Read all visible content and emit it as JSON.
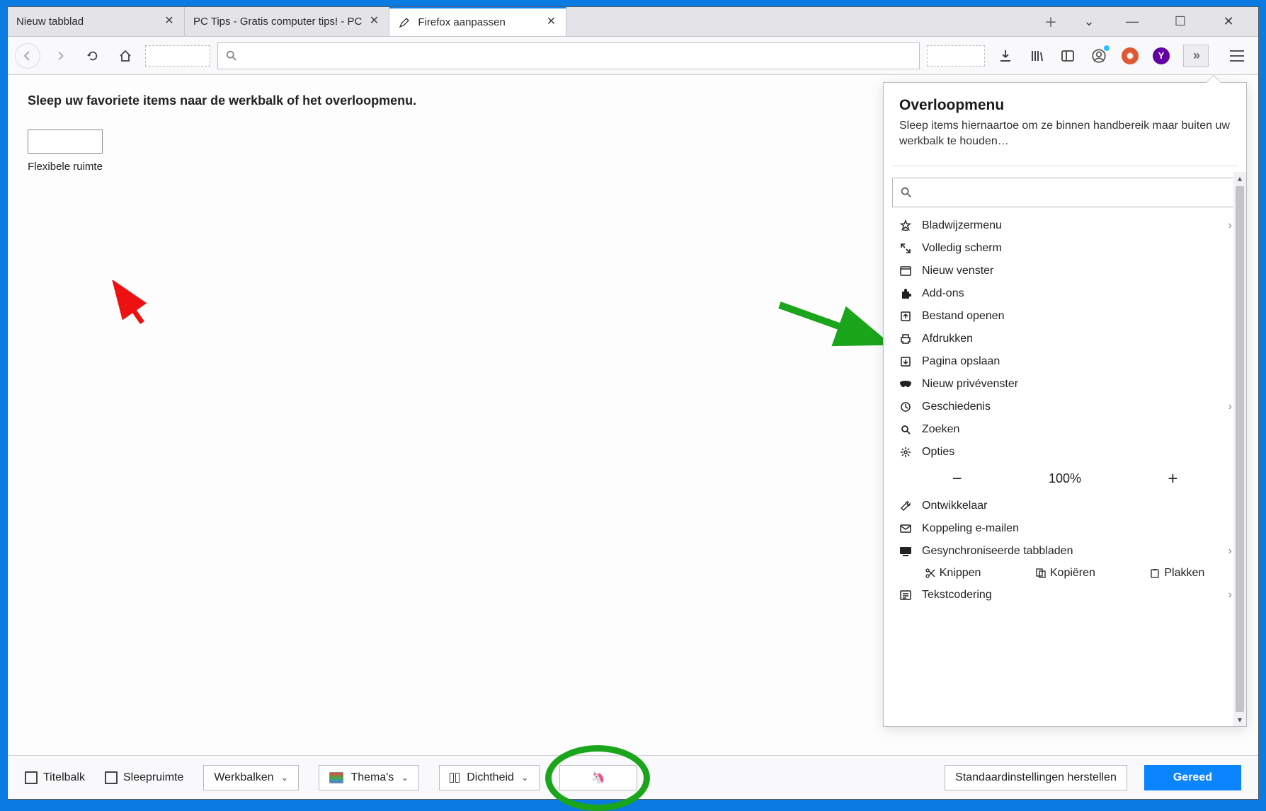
{
  "tabs": [
    {
      "label": "Nieuw tabblad"
    },
    {
      "label": "PC Tips - Gratis computer tips! - PC"
    },
    {
      "label": "Firefox aanpassen"
    }
  ],
  "main": {
    "instruction": "Sleep uw favoriete items naar de werkbalk of het overloopmenu.",
    "flex_label": "Flexibele ruimte"
  },
  "overflow": {
    "title": "Overloopmenu",
    "description": "Sleep items hiernaartoe om ze binnen handbereik maar buiten uw werkbalk te houden…",
    "items": [
      {
        "label": "Bladwijzermenu",
        "chevron": true
      },
      {
        "label": "Volledig scherm"
      },
      {
        "label": "Nieuw venster"
      },
      {
        "label": "Add-ons"
      },
      {
        "label": "Bestand openen"
      },
      {
        "label": "Afdrukken"
      },
      {
        "label": "Pagina opslaan"
      },
      {
        "label": "Nieuw privévenster"
      },
      {
        "label": "Geschiedenis",
        "chevron": true
      },
      {
        "label": "Zoeken"
      },
      {
        "label": "Opties"
      }
    ],
    "zoom_value": "100%",
    "dev_label": "Ontwikkelaar",
    "email_label": "Koppeling e-mailen",
    "sync_label": "Gesynchroniseerde tabbladen",
    "cut_label": "Knippen",
    "copy_label": "Kopiëren",
    "paste_label": "Plakken",
    "encoding_label": "Tekstcodering"
  },
  "footer": {
    "titlebar": "Titelbalk",
    "dragspace": "Sleepruimte",
    "toolbars": "Werkbalken",
    "themes": "Thema's",
    "density": "Dichtheid",
    "restore": "Standaardinstellingen herstellen",
    "done": "Gereed"
  }
}
